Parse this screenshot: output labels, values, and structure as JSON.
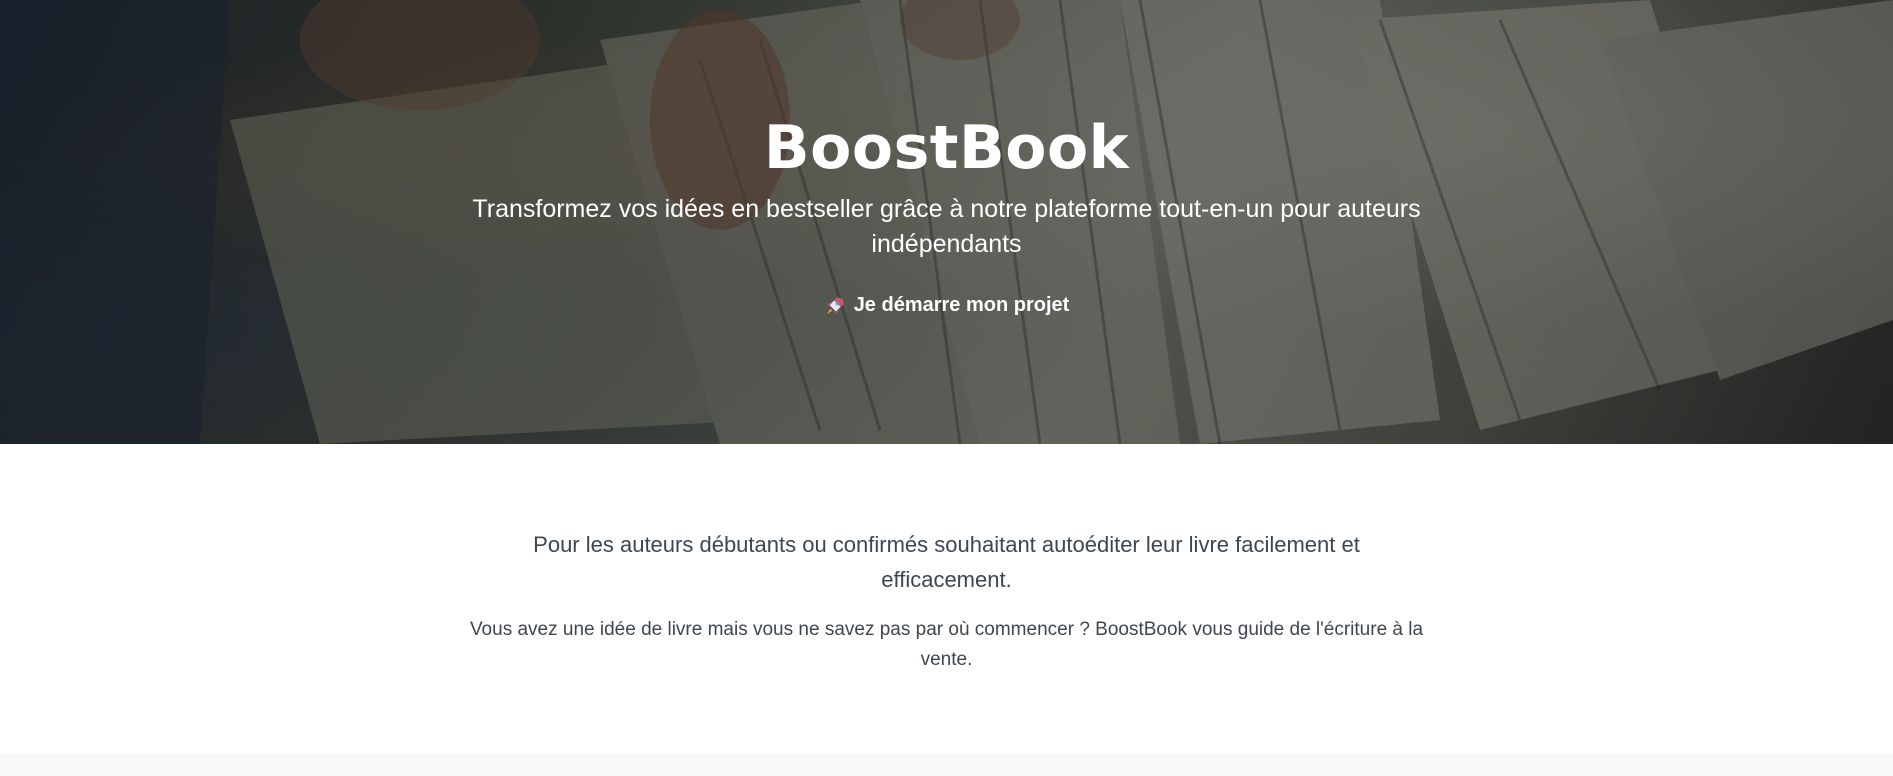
{
  "hero": {
    "title": "BoostBook",
    "subtitle": "Transformez vos idées en bestseller grâce à notre plateforme tout-en-un pour auteurs indépendants",
    "cta_label": "Je démarre mon projet",
    "cta_icon": "rocket-icon"
  },
  "intro": {
    "lead": "Pour les auteurs débutants ou confirmés souhaitant autoéditer leur livre facilement et efficacement.",
    "text": "Vous avez une idée de livre mais vous ne savez pas par où commencer ? BoostBook vous guide de l'écriture à la vente."
  },
  "colors": {
    "hero_text": "#ffffff",
    "body_text": "#3f4650",
    "footer_band": "#f6f8fa"
  }
}
